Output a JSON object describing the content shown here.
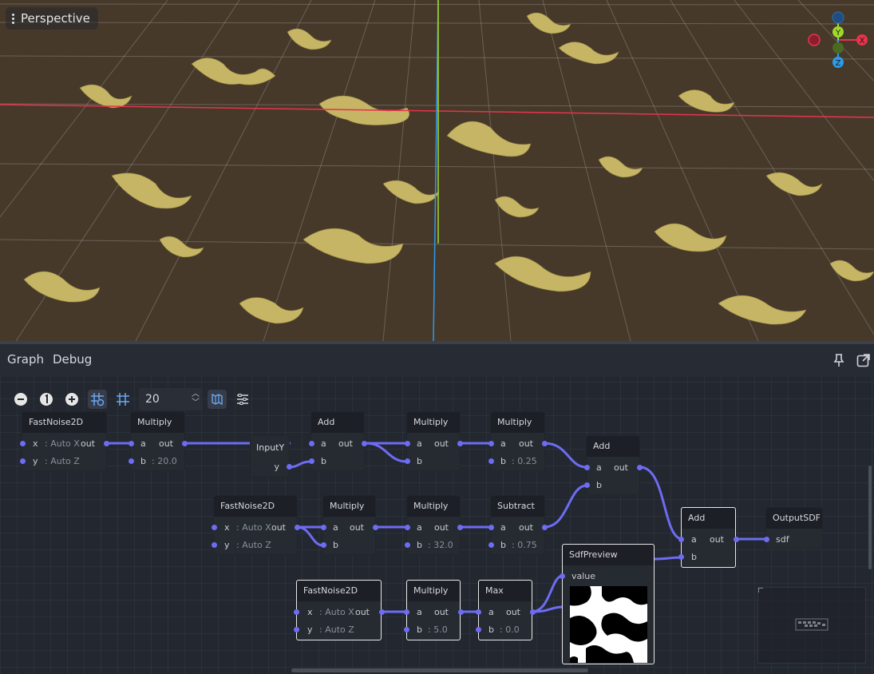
{
  "viewport": {
    "view_mode": "Perspective",
    "gizmo_axes": {
      "x": "X",
      "y": "Y",
      "z": "Z"
    },
    "colors": {
      "ground": "#46392a",
      "terrain": "#c6b565",
      "x_axis": "#e8334b",
      "z_axis": "#2d9bea",
      "y_axis": "#a0d92a"
    }
  },
  "menubar": {
    "graph": "Graph",
    "debug": "Debug"
  },
  "toolbar": {
    "zoom_value": "20"
  },
  "nodes": {
    "noise1": {
      "title": "FastNoise2D",
      "x": "x",
      "x_hint": ": Auto X",
      "y": "y",
      "y_hint": ": Auto Z",
      "out": "out"
    },
    "mul1": {
      "title": "Multiply",
      "a": "a",
      "b": "b",
      "b_hint": ": 20.0",
      "out": "out"
    },
    "inputy": {
      "title": "InputY",
      "y": "y"
    },
    "add1": {
      "title": "Add",
      "a": "a",
      "b": "b",
      "out": "out"
    },
    "mul2": {
      "title": "Multiply",
      "a": "a",
      "b": "b",
      "out": "out"
    },
    "mul3": {
      "title": "Multiply",
      "a": "a",
      "b": "b",
      "b_hint": ": 0.25",
      "out": "out"
    },
    "add2": {
      "title": "Add",
      "a": "a",
      "b": "b",
      "out": "out"
    },
    "noise2": {
      "title": "FastNoise2D",
      "x": "x",
      "x_hint": ": Auto X",
      "y": "y",
      "y_hint": ": Auto Z",
      "out": "out"
    },
    "mul4": {
      "title": "Multiply",
      "a": "a",
      "b": "b",
      "out": "out"
    },
    "mul5": {
      "title": "Multiply",
      "a": "a",
      "b": "b",
      "b_hint": ": 32.0",
      "out": "out"
    },
    "sub1": {
      "title": "Subtract",
      "a": "a",
      "b": "b",
      "b_hint": ": 0.75",
      "out": "out"
    },
    "add3": {
      "title": "Add",
      "a": "a",
      "b": "b",
      "out": "out"
    },
    "output": {
      "title": "OutputSDF",
      "sdf": "sdf"
    },
    "preview": {
      "title": "SdfPreview",
      "value": "value"
    },
    "noise3": {
      "title": "FastNoise2D",
      "x": "x",
      "x_hint": ": Auto X",
      "y": "y",
      "y_hint": ": Auto Z",
      "out": "out"
    },
    "mul6": {
      "title": "Multiply",
      "a": "a",
      "b": "b",
      "b_hint": ": 5.0",
      "out": "out"
    },
    "max1": {
      "title": "Max",
      "a": "a",
      "b": "b",
      "b_hint": ": 0.0",
      "out": "out"
    }
  },
  "wire_color": "#6d6cf2"
}
